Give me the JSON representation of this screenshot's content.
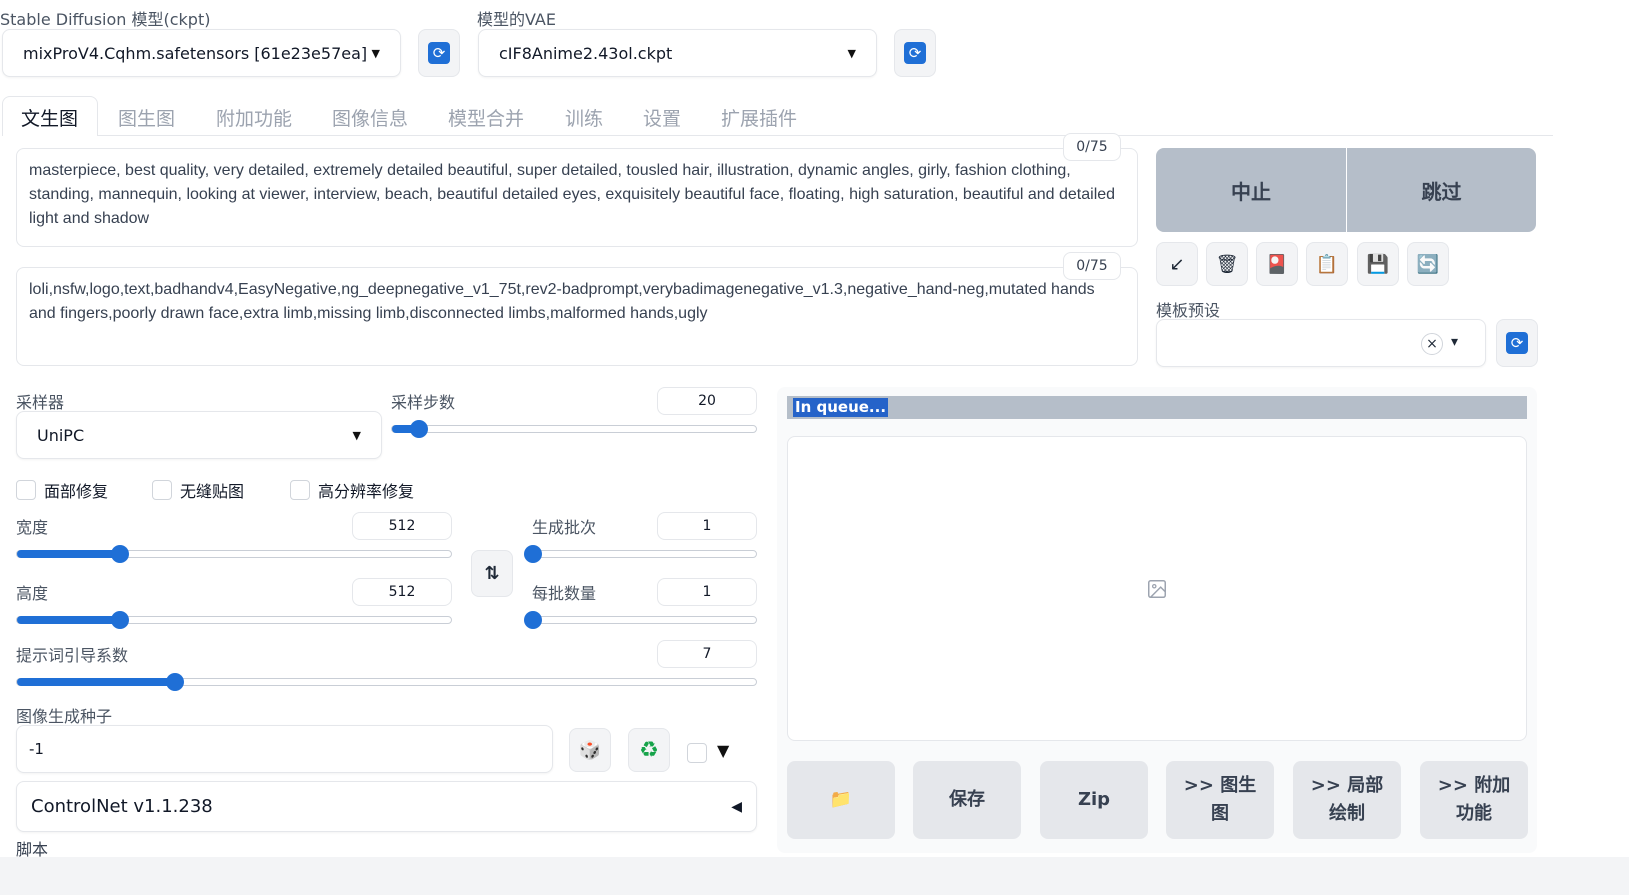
{
  "model": {
    "label": "Stable Diffusion 模型(ckpt)",
    "value": "mixProV4.Cqhm.safetensors [61e23e57ea]"
  },
  "vae": {
    "label": "模型的VAE",
    "value": "cIF8Anime2.43ol.ckpt"
  },
  "tabs": [
    {
      "label": "文生图"
    },
    {
      "label": "图生图"
    },
    {
      "label": "附加功能"
    },
    {
      "label": "图像信息"
    },
    {
      "label": "模型合并"
    },
    {
      "label": "训练"
    },
    {
      "label": "设置"
    },
    {
      "label": "扩展插件"
    }
  ],
  "prompt": {
    "counter": "0/75",
    "text": "masterpiece, best quality, very detailed, extremely detailed beautiful, super detailed, tousled hair, illustration, dynamic angles, girly, fashion clothing, standing, mannequin, looking at viewer, interview, beach, beautiful detailed eyes, exquisitely beautiful face, floating, high saturation, beautiful and detailed light and shadow"
  },
  "negative_prompt": {
    "counter": "0/75",
    "text": "loli,nsfw,logo,text,badhandv4,EasyNegative,ng_deepnegative_v1_75t,rev2-badprompt,verybadimagenegative_v1.3,negative_hand-neg,mutated hands and fingers,poorly drawn face,extra limb,missing limb,disconnected limbs,malformed hands,ugly"
  },
  "buttons": {
    "interrupt": "中止",
    "skip": "跳过"
  },
  "tools": [
    {
      "icon": "arrow-down-left-icon",
      "glyph": "↙"
    },
    {
      "icon": "trash-icon",
      "glyph": "🗑"
    },
    {
      "icon": "card-icon",
      "glyph": "🎴"
    },
    {
      "icon": "clipboard-icon",
      "glyph": "📋"
    },
    {
      "icon": "save-icon",
      "glyph": "💾"
    },
    {
      "icon": "sync-icon",
      "glyph": "🔄"
    }
  ],
  "styles": {
    "label": "模板预设",
    "clear": "×",
    "caret": "▾"
  },
  "sampler": {
    "label": "采样器",
    "value": "UniPC"
  },
  "steps": {
    "label": "采样步数",
    "value": "20",
    "fraction": 0.073
  },
  "checkboxes": [
    {
      "label": "面部修复",
      "checked": false
    },
    {
      "label": "无缝贴图",
      "checked": false
    },
    {
      "label": "高分辨率修复",
      "checked": false
    }
  ],
  "width": {
    "label": "宽度",
    "value": "512",
    "fraction": 0.238
  },
  "height": {
    "label": "高度",
    "value": "512",
    "fraction": 0.238
  },
  "swap": {
    "glyph": "⇅"
  },
  "batch_count": {
    "label": "生成批次",
    "value": "1",
    "fraction": 0.0
  },
  "batch_size": {
    "label": "每批数量",
    "value": "1",
    "fraction": 0.0
  },
  "cfg": {
    "label": "提示词引导系数",
    "value": "7",
    "fraction": 0.214
  },
  "seed": {
    "label": "图像生成种子",
    "value": "-1",
    "dice_glyph": "🎲",
    "recycle_glyph": "♻",
    "extra_glyph": "▼"
  },
  "controlnet": {
    "label": "ControlNet v1.1.238",
    "caret": "◀"
  },
  "script": {
    "label": "脚本"
  },
  "queue": {
    "text": "In queue..."
  },
  "output_actions": [
    {
      "icon": "folder-icon",
      "label": "📁"
    },
    {
      "label": "保存"
    },
    {
      "label": "Zip"
    },
    {
      "label": ">> 图生图"
    },
    {
      "label": ">> 局部绘制"
    },
    {
      "label": ">> 附加功能"
    }
  ],
  "colors": {
    "accent": "#1f6fd6",
    "action_bg": "#b5bec9",
    "queue_highlight": "#2563c9"
  }
}
